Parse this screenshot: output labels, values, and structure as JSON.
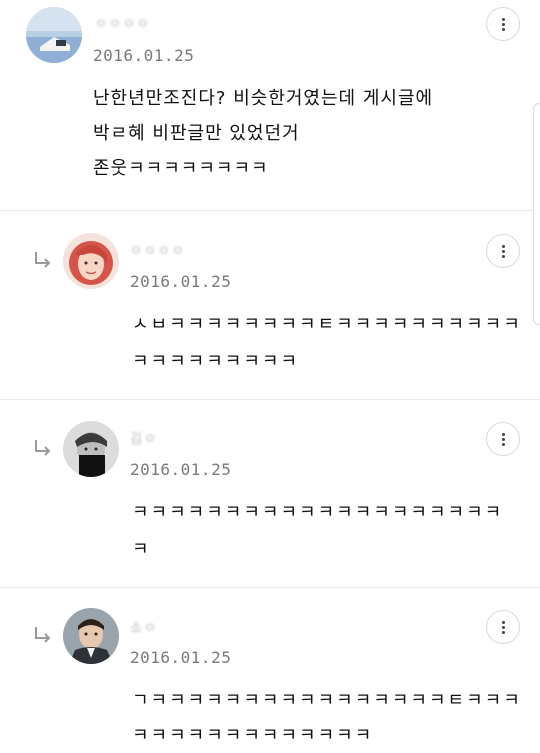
{
  "comments": [
    {
      "author": "ㅇㅇㅇㅇ",
      "date": "2016.01.25",
      "lines": [
        "난한년만조진다? 비슷한거였는데 게시글에",
        "박ㄹ혜 비판글만 있었던거",
        "존웃ㅋㅋㅋㅋㅋㅋㅋㅋ"
      ],
      "avatar": "avatar-landscape",
      "is_reply": false
    },
    {
      "author": "ㅇㅇㅇㅇ",
      "date": "2016.01.25",
      "lines": [
        "ㅅㅂㅋㅋㅋㅋㅋㅋㅋㅋㅌㅋㅋㅋㅋㅋㅋㅋㅋㅋㅋ",
        "ㅋㅋㅋㅋㅋㅋㅋㅋㅋ"
      ],
      "avatar": "avatar-redhair",
      "is_reply": true
    },
    {
      "author": "김ㅇ",
      "date": "2016.01.25",
      "lines": [
        "ㅋㅋㅋㅋㅋㅋㅋㅋㅋㅋㅋㅋㅋㅋㅋㅋㅋㅋㅋㅋ",
        "ㅋ"
      ],
      "avatar": "avatar-bw",
      "is_reply": true
    },
    {
      "author": "소ㅇ",
      "date": "2016.01.25",
      "lines": [
        "ㄱㅋㅋㅋㅋㅋㅋㅋㅋㅋㅋㅋㅋㅋㅋㅋㅋㅌㅋㅋㅋ",
        "ㅋㅋㅋㅋㅋㅋㅋㅋㅋㅋㅋㅋㅋ"
      ],
      "avatar": "avatar-suit",
      "is_reply": true
    }
  ],
  "icons": {
    "more": "more-vertical-icon",
    "reply": "reply-arrow-icon"
  },
  "colors": {
    "text": "#111111",
    "date": "#7a7a7a",
    "divider": "#e9e9e9"
  }
}
